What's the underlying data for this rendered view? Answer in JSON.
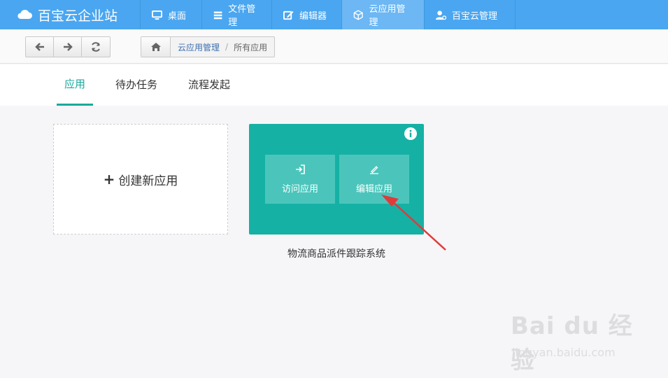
{
  "brand": {
    "title": "百宝云企业站"
  },
  "nav": [
    {
      "label": "桌面",
      "icon": "monitor-icon"
    },
    {
      "label": "文件管理",
      "icon": "list-icon"
    },
    {
      "label": "编辑器",
      "icon": "edit-icon"
    },
    {
      "label": "云应用管理",
      "icon": "cube-icon",
      "active": true
    },
    {
      "label": "百宝云管理",
      "icon": "user-gear-icon"
    }
  ],
  "toolbar": {
    "back": "arrow-left-icon",
    "forward": "arrow-right-icon",
    "refresh": "refresh-icon"
  },
  "breadcrumb": {
    "home": "home-icon",
    "parent": "云应用管理",
    "separator": "/",
    "current": "所有应用"
  },
  "tabs": [
    {
      "label": "应用",
      "active": true
    },
    {
      "label": "待办任务"
    },
    {
      "label": "流程发起"
    }
  ],
  "create_card": {
    "plus": "+",
    "label": "创建新应用"
  },
  "app_card": {
    "visit_label": "访问应用",
    "edit_label": "编辑应用",
    "name": "物流商品派件跟踪系统"
  },
  "watermark": {
    "logo": "Bai du 经验",
    "url": "jingyan.baidu.com"
  },
  "colors": {
    "nav": "#4aa6f0",
    "accent": "#1aaa9c",
    "card": "#15b1a4",
    "arrow": "#e03b3b"
  }
}
